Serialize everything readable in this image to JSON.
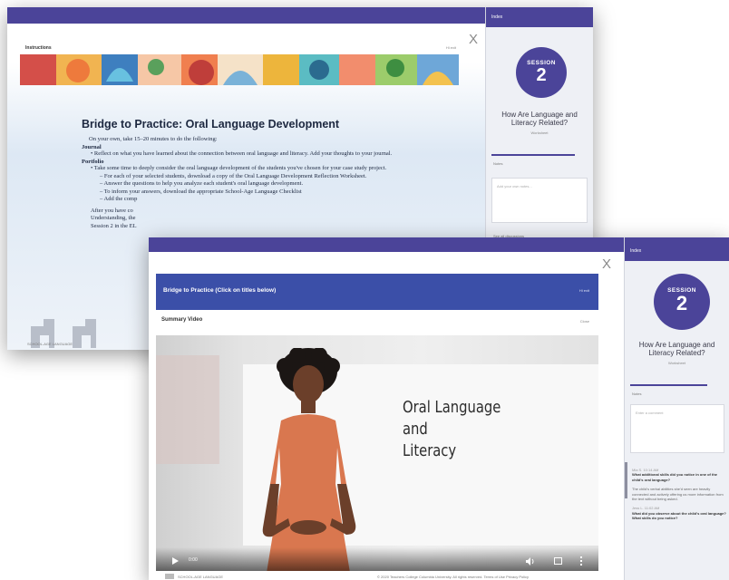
{
  "back_window": {
    "header_title": "Instructions",
    "header_right": "Hi exit",
    "close_glyph": "X",
    "doc": {
      "title": "Bridge to Practice: Oral Language Development",
      "intro": "On your own, take 15–20 minutes to do the following:",
      "journal_heading": "Journal",
      "journal_items": [
        "Reflect on what you have learned about the connection between oral language and literacy. Add your thoughts to your journal."
      ],
      "portfolio_heading": "Portfolio",
      "portfolio_lead": "Take some time to deeply consider the oral language development of the students you've chosen for your case study project.",
      "portfolio_subitems": [
        "– For each of your selected students, download a copy of the Oral Language Development Reflection Worksheet.",
        "– Answer the questions to help you analyze each student's oral language development.",
        "– To inform your answers, download the appropriate School-Age Language Checklist",
        "– Add the comp"
      ],
      "closing_lines": [
        "After you have co",
        "Understanding, the",
        "Session 2 in the EL"
      ]
    },
    "logo_caption": "SCHOOL-AGE LANGUAGE",
    "sidebar": {
      "tab_label": "Index",
      "session_word": "SESSION",
      "session_number": "2",
      "title": "How Are Language and Literacy Related?",
      "subtitle": "Worksheet",
      "label_small": "Notes",
      "textarea_placeholder": "Add your own notes...",
      "footer_small": "See all discussions"
    }
  },
  "front_window": {
    "close_glyph": "X",
    "banner_title": "Bridge to Practice (Click on titles below)",
    "banner_right": "Hi exit",
    "section_title": "Summary Video",
    "section_right": "Close",
    "video": {
      "slide_text_lines": [
        "Oral Language",
        "and",
        "Literacy"
      ],
      "time": "0:00",
      "play_icon": "play-icon",
      "volume_icon": "volume-icon",
      "fullscreen_icon": "fullscreen-icon",
      "menu_icon": "more-vertical-icon"
    },
    "footer_left": "SCHOOL-AGE LANGUAGE",
    "footer_right": "© 2020 Teachers College Columbia University. All rights reserved. Terms of Use  Privacy Policy",
    "sidebar": {
      "tab_label": "Index",
      "session_word": "SESSION",
      "session_number": "2",
      "title": "How Are Language and Literacy Related?",
      "subtitle": "Worksheet",
      "label_small": "Notes",
      "textarea_placeholder": "Enter a comment",
      "comments": [
        {
          "meta": "Mia S.  10:14 AM",
          "text": "What additional skills did you notice in one of the child's oral language?"
        },
        {
          "meta": "",
          "text": "The child's verbal abilities she'd seen are heavily connected and actively offering us more information from the text without being asked."
        },
        {
          "meta": "Jess L.  11:02 AM",
          "text": "What did you observe about the child's oral language? What skills do you notice?"
        }
      ]
    }
  },
  "colors": {
    "brand_purple": "#4b4499",
    "banner_blue": "#3b4fa8",
    "dress_orange": "#d9774f",
    "doc_bg_top": "#e7eef6"
  }
}
